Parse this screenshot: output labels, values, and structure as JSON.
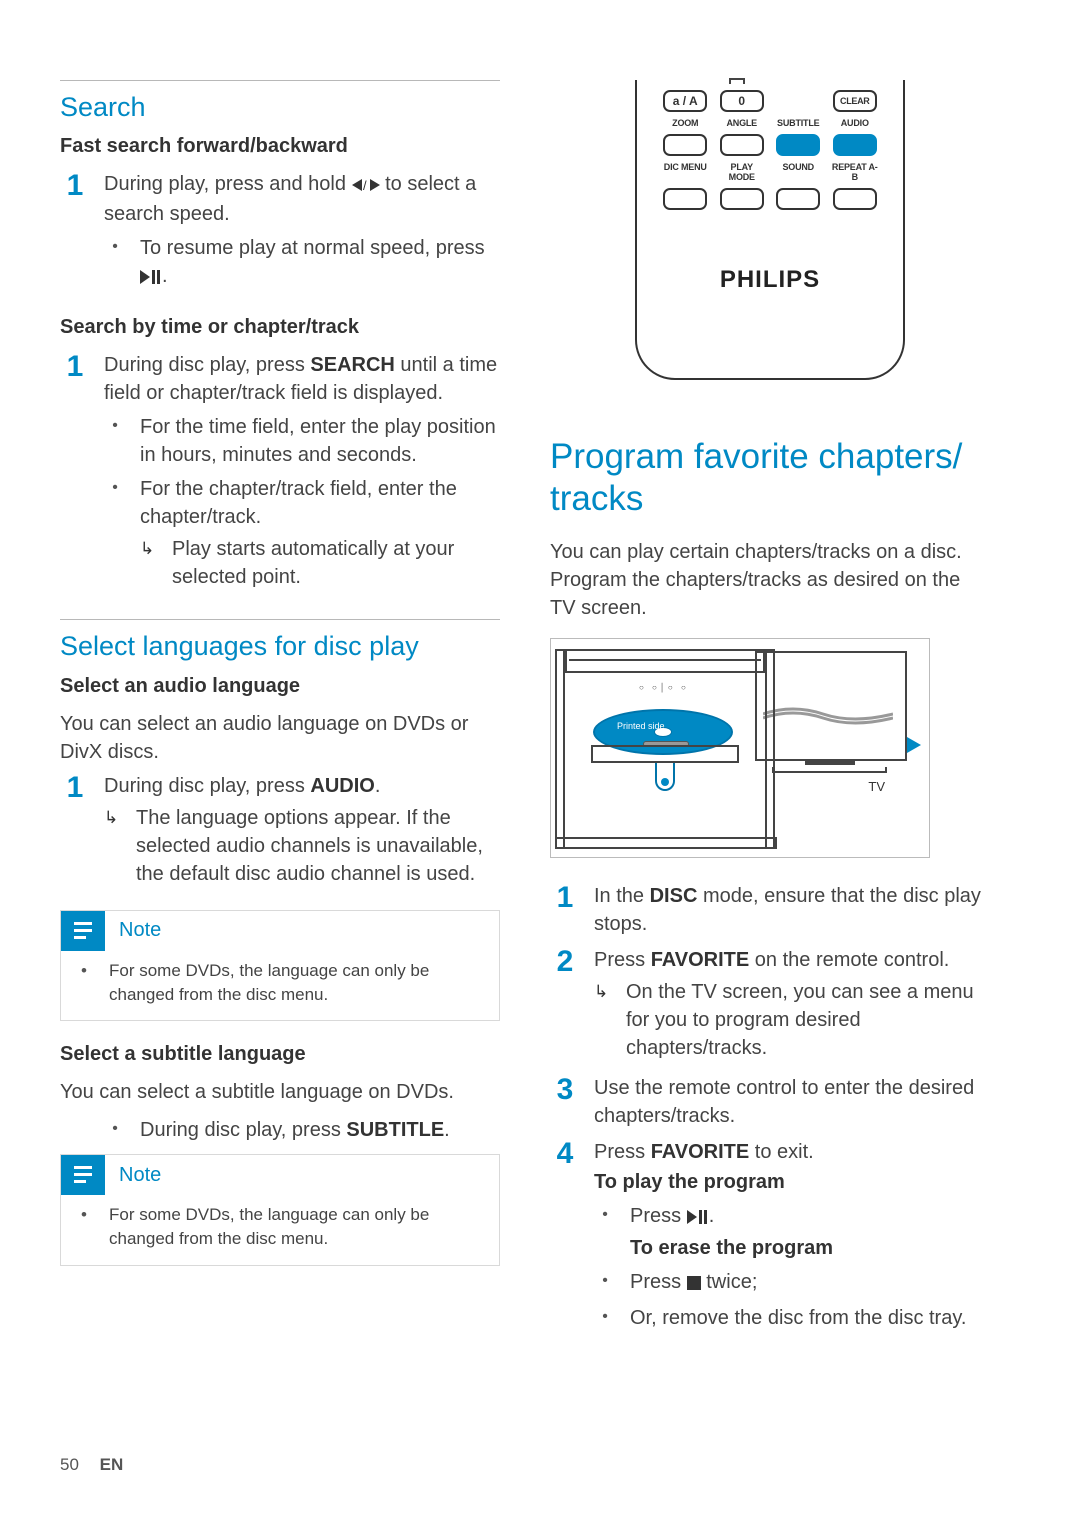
{
  "left": {
    "search": {
      "heading": "Search",
      "fastTitle": "Fast search forward/backward",
      "fastStep1a": "During play, press and hold ",
      "fastStep1b": " to select a search speed.",
      "fastResumeA": "To resume play at normal speed, press ",
      "fastResumeB": ".",
      "byTimeTitle": "Search by time or chapter/track",
      "byTimeStep1a": "During disc play, press ",
      "byTimeStep1b": " until a time field or chapter/track field is displayed.",
      "byTimeKey": "SEARCH",
      "byTimeBullet1": "For the time field, enter the play position in hours, minutes and seconds.",
      "byTimeBullet2": "For the chapter/track field, enter the chapter/track.",
      "byTimeArrow": "Play starts automatically at your selected point."
    },
    "lang": {
      "heading": "Select languages for disc play",
      "audioTitle": "Select an audio language",
      "audioIntro": "You can select an audio language on DVDs or DivX discs.",
      "audioStep1a": "During disc play, press ",
      "audioKey": "AUDIO",
      "audioStep1b": ".",
      "audioArrow": "The language options appear. If the selected audio channels is unavailable, the default disc audio channel is used.",
      "note1Title": "Note",
      "note1Body": "For some DVDs, the language can only be changed from the disc menu.",
      "subTitle": "Select a subtitle language",
      "subIntro": "You can select a subtitle language on DVDs.",
      "subBulletA": "During disc play, press ",
      "subKey": "SUBTITLE",
      "subBulletB": ".",
      "note2Title": "Note",
      "note2Body": "For some DVDs, the language can only be changed from the disc menu."
    }
  },
  "right": {
    "remote": {
      "row1": [
        "a / A",
        "0",
        "",
        "CLEAR"
      ],
      "row2": [
        "ZOOM",
        "ANGLE",
        "SUBTITLE",
        "AUDIO"
      ],
      "row3": [
        "DIC MENU",
        "PLAY MODE",
        "SOUND",
        "REPEAT A-B"
      ],
      "brand": "PHILIPS"
    },
    "program": {
      "heading": "Program favorite chapters/ tracks",
      "intro": "You can play certain chapters/tracks on a disc. Program the chapters/tracks as desired on the TV screen.",
      "tvLabel": "TV",
      "printed": "Printed side",
      "step1a": "In the ",
      "step1key": "DISC",
      "step1b": " mode, ensure that the disc play stops.",
      "step2a": "Press ",
      "step2key": "FAVORITE",
      "step2b": " on the remote control.",
      "step2arrow": "On the TV screen, you can see a menu for you to program desired chapters/tracks.",
      "step3": "Use the remote control to enter the desired chapters/tracks.",
      "step4a": "Press ",
      "step4key": "FAVORITE",
      "step4b": " to exit.",
      "playTitle": "To play the program",
      "playBulletA": "Press ",
      "playBulletB": ".",
      "eraseTitle": "To erase the program",
      "eraseBulletA": "Press ",
      "eraseBulletB": " twice;",
      "eraseBullet2": "Or, remove the disc from the disc tray."
    }
  },
  "footer": {
    "page": "50",
    "lang": "EN"
  }
}
